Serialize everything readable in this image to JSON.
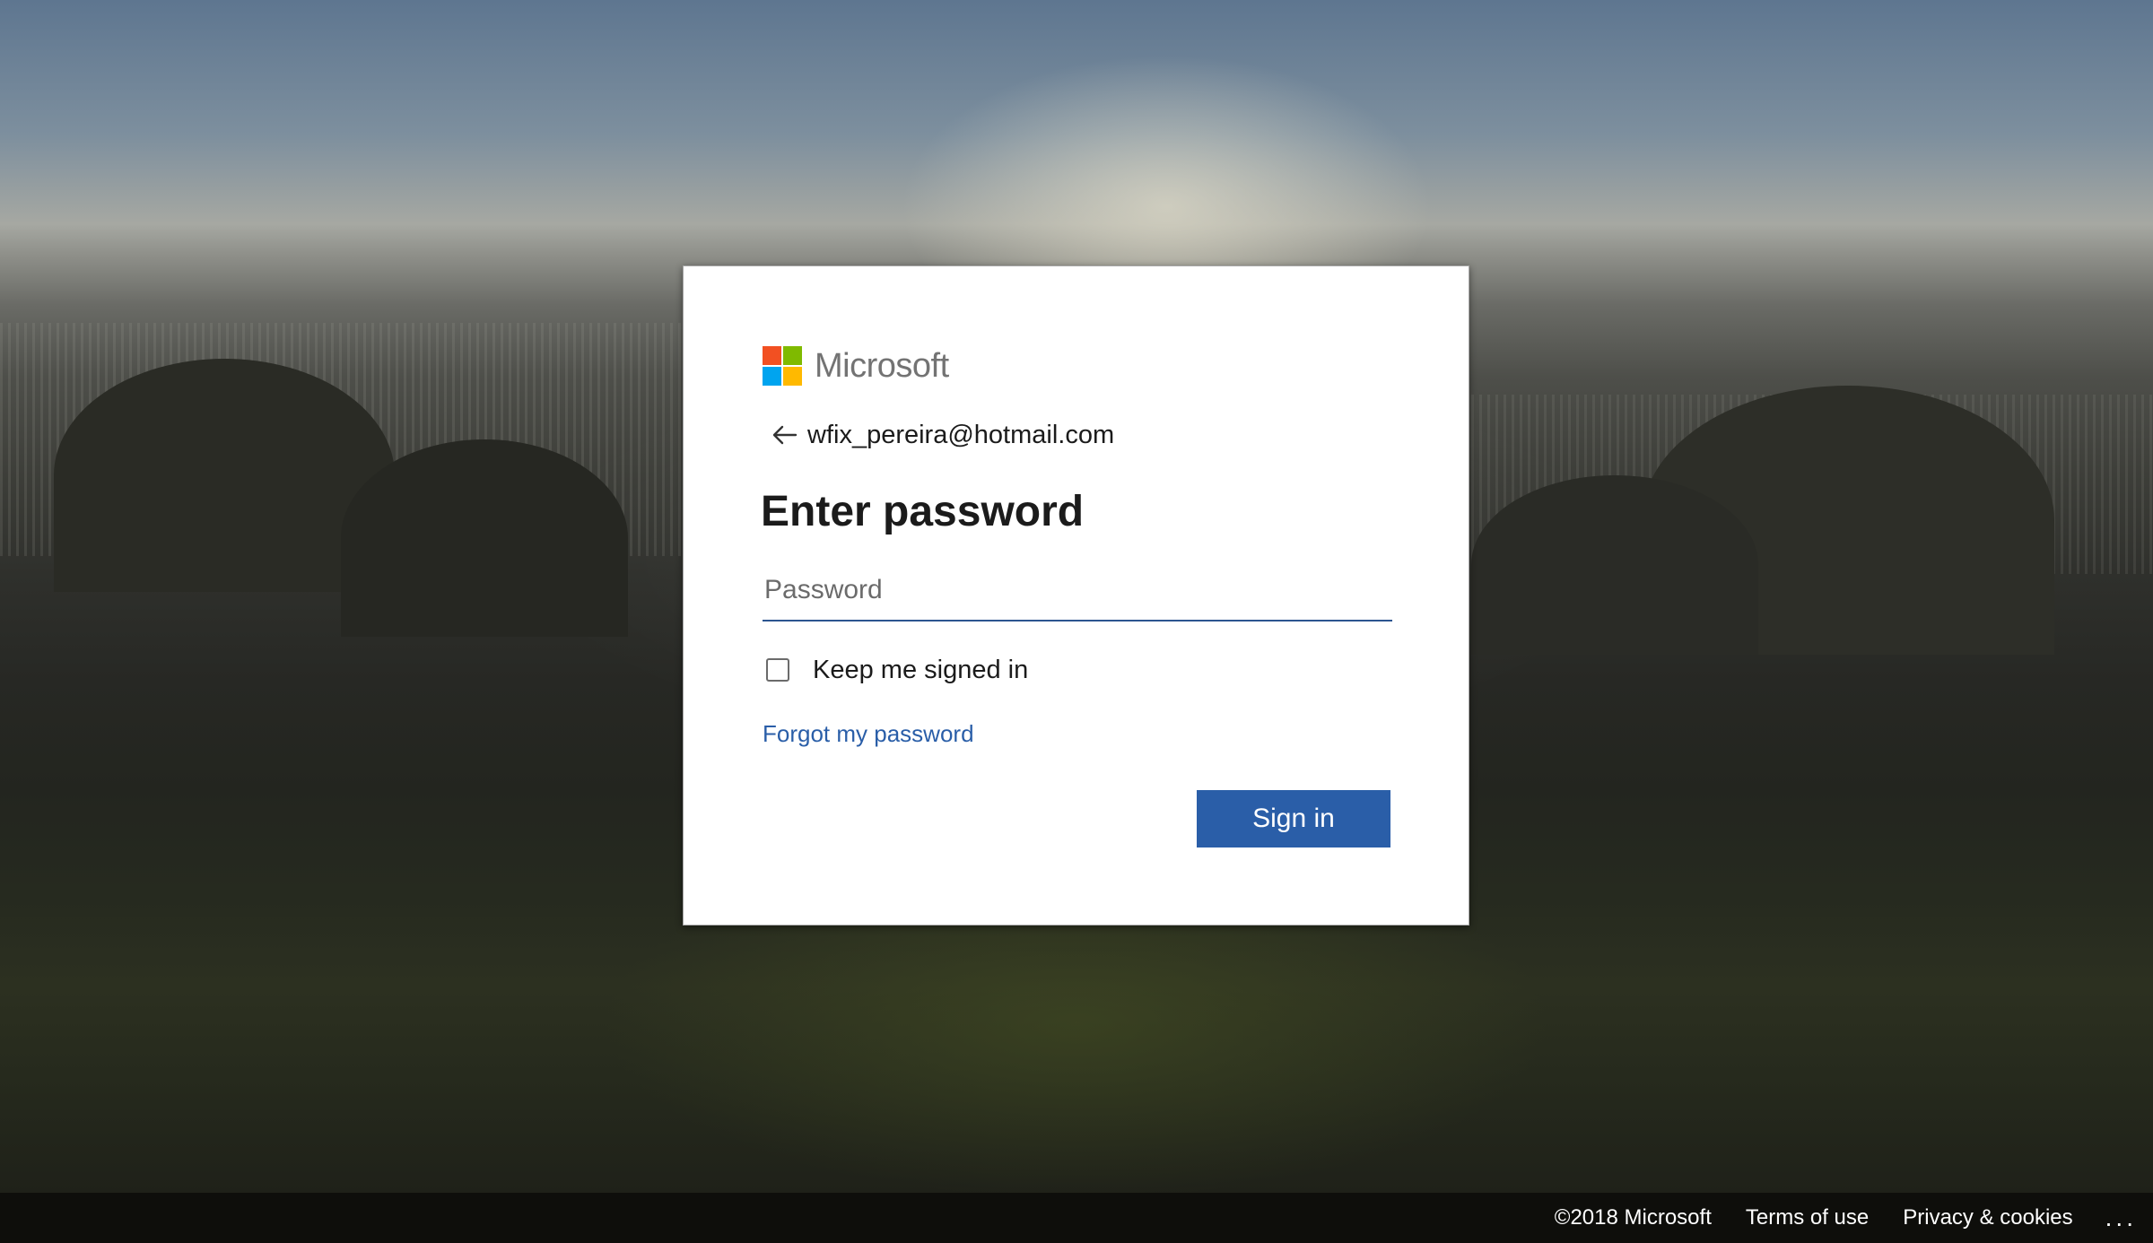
{
  "brand": {
    "name": "Microsoft",
    "logo_colors": [
      "#f25022",
      "#7fba00",
      "#00a4ef",
      "#ffb900"
    ]
  },
  "identity": {
    "back_icon": "arrow-left-icon",
    "email": "wfix_pereira@hotmail.com"
  },
  "form": {
    "title": "Enter password",
    "password_value": "",
    "password_placeholder": "Password",
    "keep_signed_in_label": "Keep me signed in",
    "keep_signed_in_checked": false,
    "forgot_link": "Forgot my password",
    "submit_label": "Sign in"
  },
  "footer": {
    "copyright": "©2018 Microsoft",
    "terms": "Terms of use",
    "privacy": "Privacy & cookies",
    "more": "..."
  },
  "colors": {
    "accent": "#2a5ea8",
    "input_underline": "#2c5590",
    "text": "#1b1b1b"
  }
}
